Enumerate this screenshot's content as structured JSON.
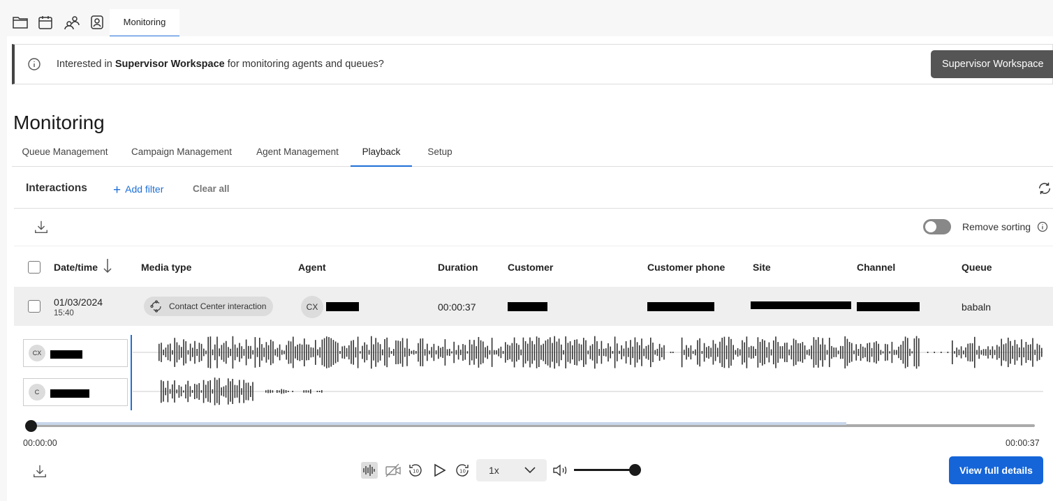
{
  "top_tab": {
    "label": "Monitoring"
  },
  "banner": {
    "text_prefix": "Interested in ",
    "text_bold": "Supervisor Workspace",
    "text_suffix": " for monitoring agents and queues?",
    "button_label": "Supervisor Workspace"
  },
  "page_title": "Monitoring",
  "subtabs": [
    "Queue Management",
    "Campaign Management",
    "Agent Management",
    "Playback",
    "Setup"
  ],
  "active_subtab": "Playback",
  "toolbar": {
    "title": "Interactions",
    "add_filter": "Add filter",
    "clear_all": "Clear all",
    "remove_sorting": "Remove sorting",
    "remove_sorting_enabled": false
  },
  "columns": [
    "Date/time",
    "Media type",
    "Agent",
    "Duration",
    "Customer",
    "Customer phone",
    "Site",
    "Channel",
    "Queue"
  ],
  "row": {
    "date": "01/03/2024",
    "time": "15:40",
    "media_type": "Contact Center interaction",
    "agent_initials": "CX",
    "duration": "00:00:37",
    "queue": "babaln"
  },
  "tracks": [
    {
      "initials": "CX"
    },
    {
      "initials": "C"
    }
  ],
  "player": {
    "start_time": "00:00:00",
    "end_time": "00:00:37",
    "speed": "1x",
    "progress": 0,
    "volume": 1,
    "view_details": "View full details"
  },
  "colors": {
    "accent": "#1565d8",
    "banner_button": "#555555"
  }
}
